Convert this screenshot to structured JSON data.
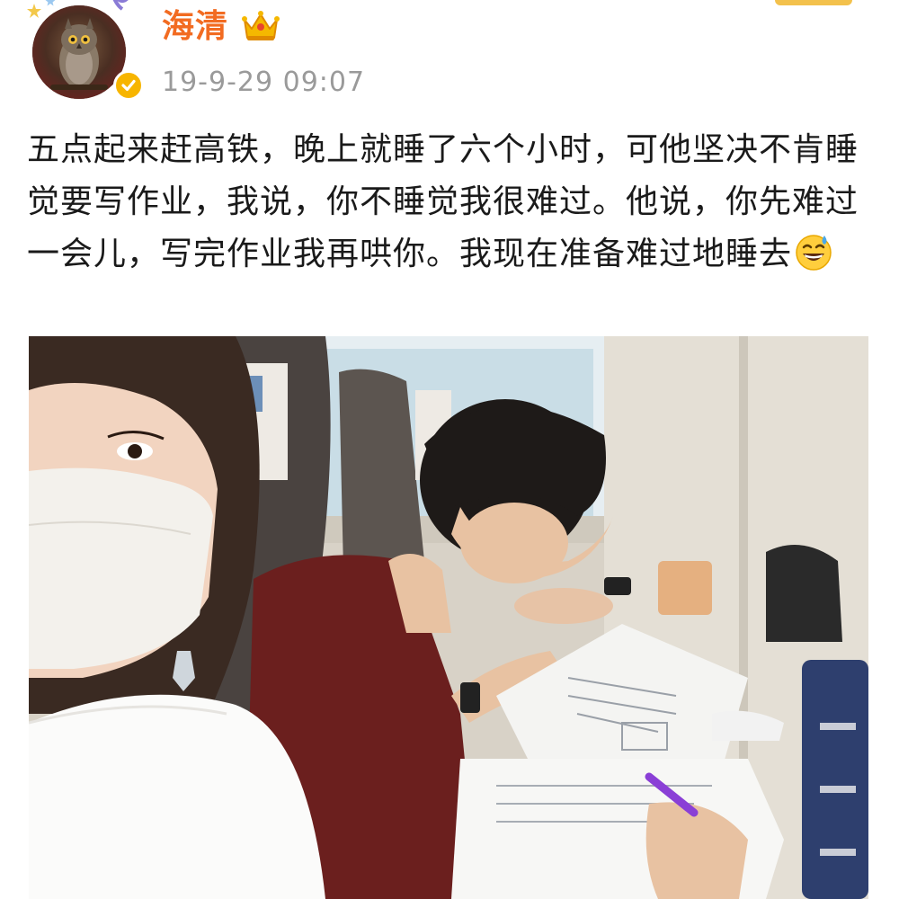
{
  "post": {
    "author_name": "海清",
    "timestamp": "19-9-29 09:07",
    "text": "五点起来赶高铁，晚上就睡了六个小时，可他坚决不肯睡觉要写作业，我说，你不睡觉我很难过。他说，你先难过一会儿，写完作业我再哄你。我现在准备难过地睡去",
    "emoji_icon": "grinning-sweat-emoji",
    "photo_icon": "train-homework-photo"
  },
  "colors": {
    "username": "#f26b21",
    "timestamp": "#9a9a9a",
    "body_text": "#1a1a1a",
    "verified_badge": "#f7b500",
    "crown": "#f5b800"
  }
}
